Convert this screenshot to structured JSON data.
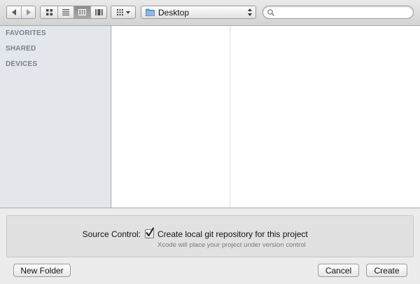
{
  "toolbar": {
    "nav_icons": [
      "back-arrow-icon",
      "forward-arrow-icon"
    ],
    "view_modes": [
      "icon-view",
      "list-view",
      "column-view",
      "cover-flow-view"
    ],
    "active_view": "column-view",
    "location": "Desktop",
    "search": {
      "value": "",
      "placeholder": ""
    }
  },
  "sidebar": {
    "groups": [
      "FAVORITES",
      "SHARED",
      "DEVICES"
    ]
  },
  "options": {
    "source_control_label": "Source Control:",
    "git_checkbox_label": "Create local git repository for this project",
    "git_checkbox_checked": true,
    "hint": "Xcode will place your project under version control"
  },
  "buttons": {
    "new_folder": "New Folder",
    "cancel": "Cancel",
    "create": "Create"
  },
  "colors": {
    "sidebar_bg": "#e3e7ec",
    "sidebar_header": "#7a808a",
    "window_bg": "#ececec",
    "folder_icon": "#5b8fd0"
  }
}
